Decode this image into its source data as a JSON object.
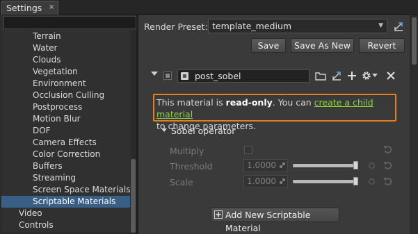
{
  "tab": {
    "title": "Settings",
    "close": "×"
  },
  "sidebar": {
    "sub_items": [
      "Terrain",
      "Water",
      "Clouds",
      "Vegetation",
      "Environment",
      "Occlusion Culling",
      "Postprocess",
      "Motion Blur",
      "DOF",
      "Camera Effects",
      "Color Correction",
      "Buffers",
      "Streaming",
      "Screen Space Materials"
    ],
    "selected_item": "Scriptable Materials",
    "top_items": [
      "Video",
      "Controls"
    ]
  },
  "preset": {
    "label": "Render Preset:",
    "value": "template_medium"
  },
  "buttons": {
    "save": "Save",
    "save_as_new": "Save As New",
    "revert": "Revert"
  },
  "material": {
    "name": "post_sobel"
  },
  "notice": {
    "prefix": "This material is ",
    "bold": "read-only",
    "middle": ". You can ",
    "link": "create a child material",
    "suffix": "to change parameters."
  },
  "group": {
    "title": "Sobel operator"
  },
  "params": [
    {
      "label": "Multiply",
      "kind": "checkbox"
    },
    {
      "label": "Threshold",
      "kind": "slider",
      "value": "1.0000",
      "level": 1.0
    },
    {
      "label": "Scale",
      "kind": "slider",
      "value": "1.0000",
      "level": 1.0
    }
  ],
  "add_button": {
    "label": "Add New Scriptable Material"
  },
  "colors": {
    "selection": "#3a5f86",
    "notice_border": "#e67e22",
    "link": "#8cd63c",
    "accent_icon": "#4a9de0"
  },
  "icons": [
    "close-icon",
    "dropdown-arrow-icon",
    "export-icon",
    "folder-icon",
    "plus-icon",
    "gear-icon",
    "delete-icon",
    "reset-icon",
    "expand-icon"
  ]
}
